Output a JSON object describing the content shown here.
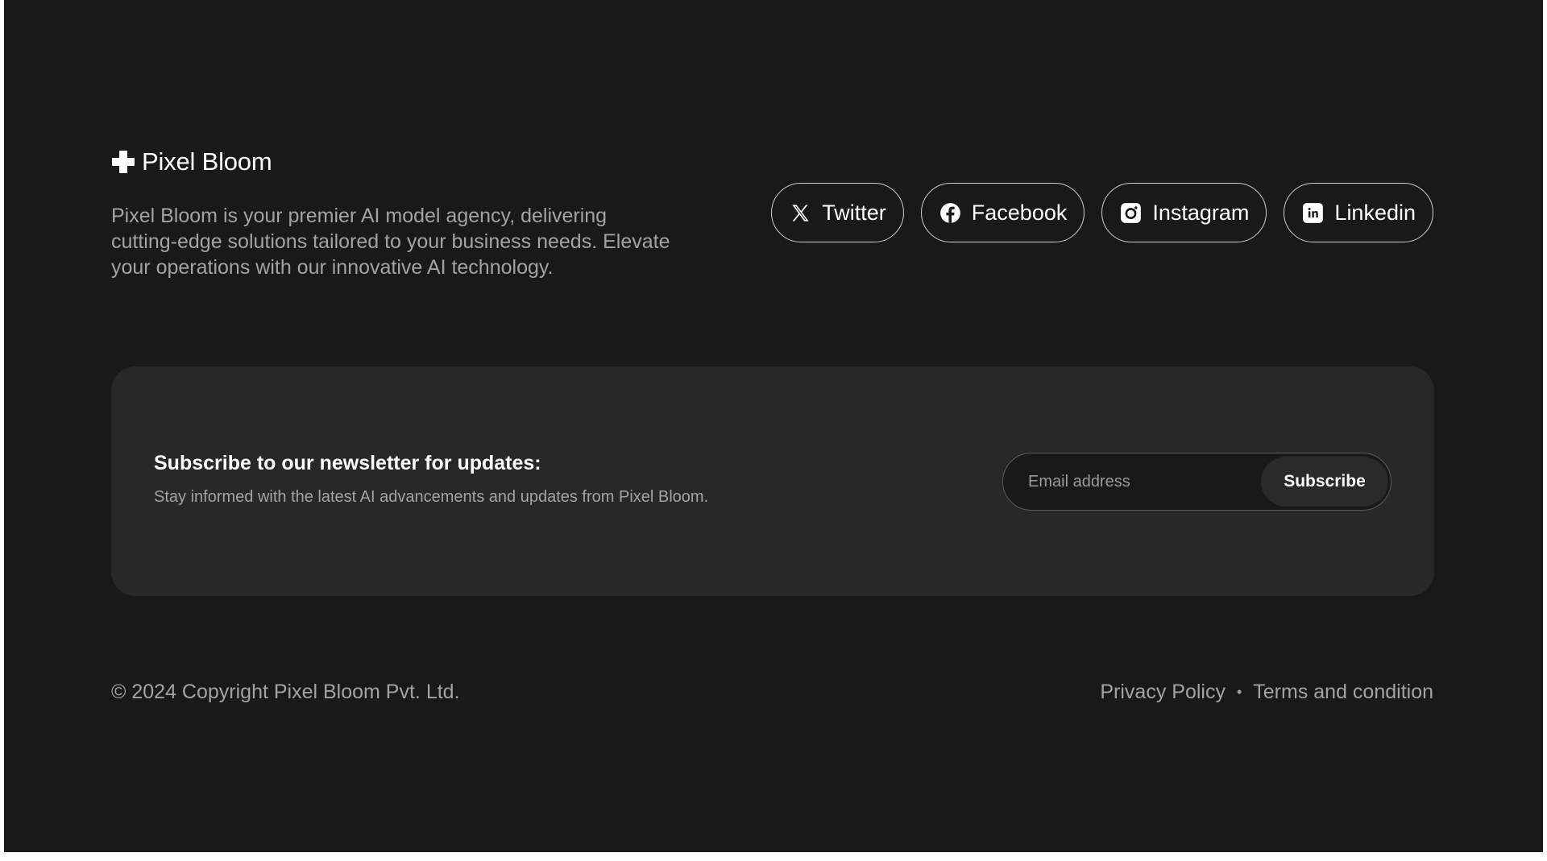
{
  "brand": {
    "name": "Pixel Bloom",
    "tagline": "Pixel Bloom is your premier AI model agency, delivering cutting-edge solutions tailored to your business needs. Elevate your operations with our innovative AI technology.",
    "logo_icon": "cross-plus-icon"
  },
  "social": [
    {
      "label": "Twitter",
      "icon": "x-twitter-icon"
    },
    {
      "label": "Facebook",
      "icon": "facebook-icon"
    },
    {
      "label": "Instagram",
      "icon": "instagram-icon"
    },
    {
      "label": "Linkedin",
      "icon": "linkedin-icon"
    }
  ],
  "newsletter": {
    "title": "Subscribe to our newsletter for updates:",
    "subtitle": "Stay informed with the latest AI advancements and updates from Pixel Bloom.",
    "email_placeholder": "Email address",
    "email_value": "",
    "button_label": "Subscribe"
  },
  "footer": {
    "copyright": "© 2024 Copyright Pixel Bloom Pvt. Ltd.",
    "privacy_label": "Privacy Policy",
    "separator": "•",
    "terms_label": "Terms and condition"
  },
  "colors": {
    "background": "#191919",
    "panel": "#282828",
    "text_primary": "#ffffff",
    "text_secondary": "#a3a3a3"
  }
}
